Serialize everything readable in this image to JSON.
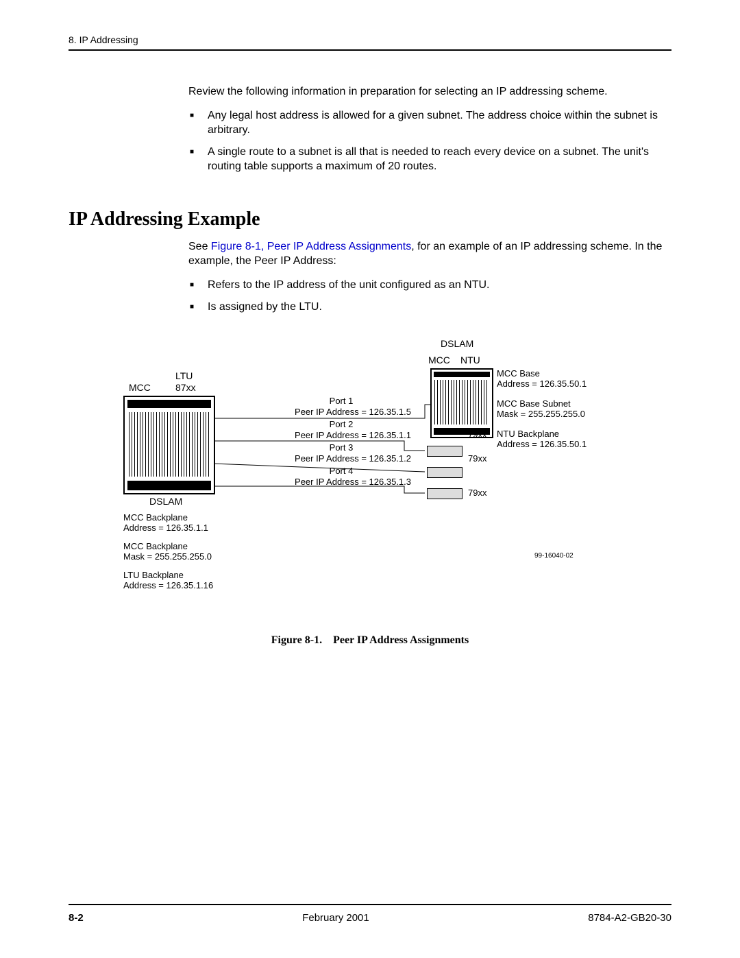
{
  "header": {
    "chapter": "8. IP Addressing"
  },
  "intro": {
    "lead": "Review the following information in preparation for selecting an IP addressing scheme.",
    "bullets": [
      "Any legal host address is allowed for a given subnet. The address choice within the subnet is arbitrary.",
      "A single route to a subnet is all that is needed to reach every device on a subnet. The unit's routing table supports a maximum of 20 routes."
    ]
  },
  "section_title": "IP Addressing Example",
  "example": {
    "see_prefix": "See ",
    "see_link": "Figure 8-1, Peer IP Address Assignments",
    "see_suffix": ", for an example of an IP addressing scheme. In the example, the Peer IP Address:",
    "bullets": [
      "Refers to the IP address of the unit configured as an NTU.",
      "Is assigned by the LTU."
    ]
  },
  "diagram": {
    "left": {
      "label_mcc": "MCC",
      "label_ltu": "LTU",
      "label_87xx": "87xx",
      "label_dslam": "DSLAM",
      "mcc_backplane_addr": "MCC Backplane\nAddress = 126.35.1.1",
      "mcc_backplane_mask": "MCC Backplane\nMask = 255.255.255.0",
      "ltu_backplane_addr": "LTU Backplane\nAddress = 126.35.1.16"
    },
    "ports": [
      {
        "label": "Port 1",
        "peer": "Peer IP Address = 126.35.1.5",
        "dest": "right_dslam"
      },
      {
        "label": "Port 2",
        "peer": "Peer IP Address = 126.35.1.1",
        "dest": "79xx"
      },
      {
        "label": "Port 3",
        "peer": "Peer IP Address = 126.35.1.2",
        "dest": "79xx"
      },
      {
        "label": "Port 4",
        "peer": "Peer IP Address = 126.35.1.3",
        "dest": "79xx"
      }
    ],
    "right": {
      "label_dslam": "DSLAM",
      "label_mcc": "MCC",
      "label_ntu": "NTU",
      "mcc_base_addr": "MCC Base\nAddress = 126.35.50.1",
      "mcc_base_mask": "MCC Base Subnet\nMask = 255.255.255.0",
      "ntu_backplane_addr": "NTU Backplane\nAddress = 126.35.50.1",
      "label_79xx": "79xx"
    },
    "drawing_number": "99-16040-02"
  },
  "figure_caption": "Figure 8-1. Peer IP Address Assignments",
  "footer": {
    "page": "8-2",
    "date": "February 2001",
    "docnum": "8784-A2-GB20-30"
  }
}
